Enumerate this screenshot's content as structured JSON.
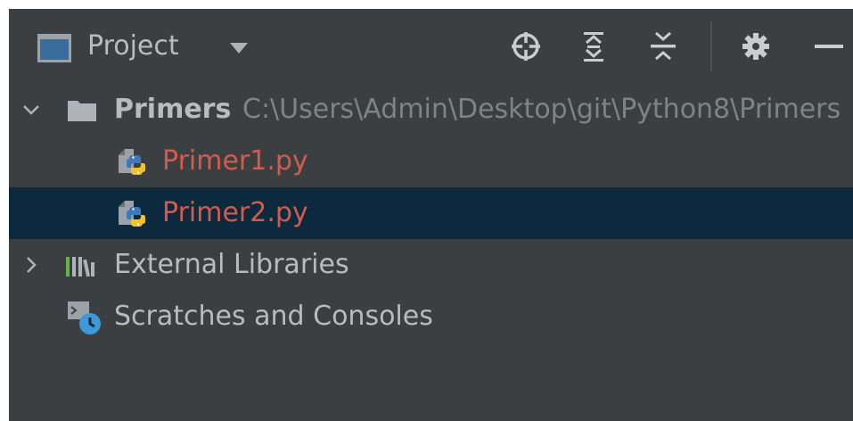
{
  "header": {
    "title": "Project",
    "tools": [
      {
        "icon": "locate-icon"
      },
      {
        "icon": "expand-all-icon"
      },
      {
        "icon": "collapse-all-icon"
      },
      {
        "icon": "gear-icon"
      },
      {
        "icon": "minimize-icon"
      }
    ]
  },
  "tree": {
    "root": {
      "name": "Primers",
      "path": "C:\\Users\\Admin\\Desktop\\git\\Python8\\Primers",
      "expanded": true
    },
    "files": [
      {
        "name": "Primer1.py",
        "status": "modified",
        "selected": false
      },
      {
        "name": "Primer2.py",
        "status": "modified",
        "selected": true
      }
    ],
    "external_libraries": "External Libraries",
    "scratches": "Scratches and Consoles"
  },
  "colors": {
    "background": "#3c3f41",
    "selection": "#0d293e",
    "modified_file": "#d45b4b",
    "text": "#bbbbbb",
    "path_text": "#7e8486"
  }
}
